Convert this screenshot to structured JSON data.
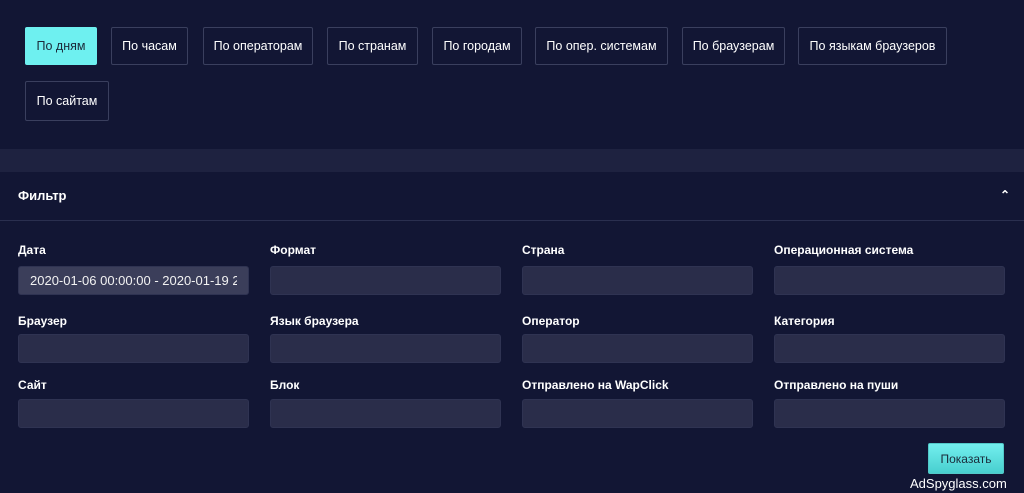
{
  "tabs": [
    {
      "label": "По дням",
      "active": true
    },
    {
      "label": "По часам"
    },
    {
      "label": "По операторам"
    },
    {
      "label": "По странам"
    },
    {
      "label": "По городам"
    },
    {
      "label": "По опер. системам"
    },
    {
      "label": "По браузерам"
    },
    {
      "label": "По языкам браузеров"
    },
    {
      "label": "По сайтам"
    }
  ],
  "filter": {
    "title": "Фильтр",
    "collapse_icon": "chevron-up-icon",
    "fields": [
      {
        "label": "Дата",
        "value": "2020-01-06 00:00:00 - 2020-01-19 2"
      },
      {
        "label": "Формат",
        "value": ""
      },
      {
        "label": "Страна",
        "value": ""
      },
      {
        "label": "Операционная система",
        "value": ""
      },
      {
        "label": "Браузер",
        "value": ""
      },
      {
        "label": "Язык браузера",
        "value": ""
      },
      {
        "label": "Оператор",
        "value": ""
      },
      {
        "label": "Категория",
        "value": ""
      },
      {
        "label": "Сайт",
        "value": ""
      },
      {
        "label": "Блок",
        "value": ""
      },
      {
        "label": "Отправлено на WapClick",
        "value": ""
      },
      {
        "label": "Отправлено на пуши",
        "value": ""
      }
    ],
    "submit_label": "Показать"
  },
  "watermark": "AdSpyglass.com",
  "colors": {
    "background": "#121634",
    "accent": "#6ef0f0",
    "input_bg": "#2a2d4a"
  }
}
